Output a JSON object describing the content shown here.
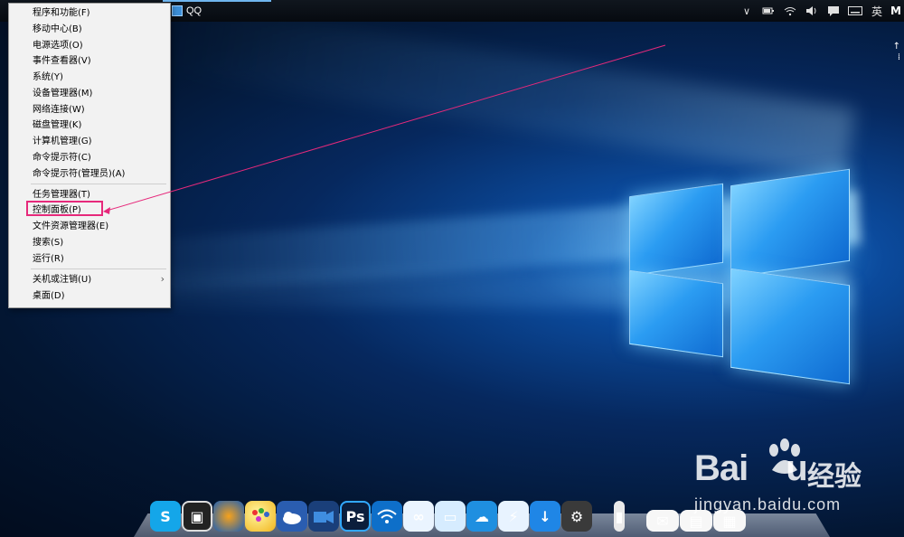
{
  "topbar": {
    "qq_label": "QQ",
    "tray": {
      "chevron": "∨",
      "language": "英",
      "mode": "M"
    }
  },
  "context_menu": {
    "items": [
      {
        "label": "程序和功能(F)"
      },
      {
        "label": "移动中心(B)"
      },
      {
        "label": "电源选项(O)"
      },
      {
        "label": "事件查看器(V)"
      },
      {
        "label": "系统(Y)"
      },
      {
        "label": "设备管理器(M)"
      },
      {
        "label": "网络连接(W)"
      },
      {
        "label": "磁盘管理(K)"
      },
      {
        "label": "计算机管理(G)"
      },
      {
        "label": "命令提示符(C)"
      },
      {
        "label": "命令提示符(管理员)(A)"
      },
      {
        "label": "任务管理器(T)"
      },
      {
        "label": "控制面板(P)",
        "highlighted": true
      },
      {
        "label": "文件资源管理器(E)"
      },
      {
        "label": "搜索(S)"
      },
      {
        "label": "运行(R)"
      },
      {
        "label": "关机或注销(U)",
        "has_submenu": true
      },
      {
        "label": "桌面(D)"
      }
    ],
    "highlight_color": "#e6297b"
  },
  "dock": {
    "apps": [
      {
        "icon": "skype-icon",
        "glyph": "S"
      },
      {
        "icon": "film-icon",
        "glyph": "▣"
      },
      {
        "icon": "firefox-icon",
        "glyph": ""
      },
      {
        "icon": "paint-palette-icon",
        "glyph": ""
      },
      {
        "icon": "weather-icon",
        "glyph": ""
      },
      {
        "icon": "video-icon",
        "glyph": ""
      },
      {
        "icon": "photoshop-icon",
        "glyph": "Ps"
      },
      {
        "icon": "wifi-icon",
        "glyph": "◠"
      },
      {
        "icon": "baidu-netdisk-icon",
        "glyph": "∞"
      },
      {
        "icon": "monitor-icon",
        "glyph": "▭"
      },
      {
        "icon": "cloud-icon",
        "glyph": "☁"
      },
      {
        "icon": "lightning-icon",
        "glyph": "⚡"
      },
      {
        "icon": "download-icon",
        "glyph": "↓"
      },
      {
        "icon": "settings-gear-icon",
        "glyph": "⚙"
      },
      {
        "icon": "small-file-icon",
        "glyph": "▮"
      },
      {
        "icon": "document-icon",
        "glyph": "✉"
      },
      {
        "icon": "document-icon",
        "glyph": "▤"
      },
      {
        "icon": "document-icon",
        "glyph": "▦"
      }
    ]
  },
  "watermark": {
    "brand_latin": "Bai",
    "brand_latin2": "u",
    "brand_cn": "经验",
    "url": "jingyan.baidu.com"
  },
  "colors": {
    "accent": "#6fb6f0",
    "menu_bg": "#f2f2f2",
    "annotation": "#e6297b"
  }
}
